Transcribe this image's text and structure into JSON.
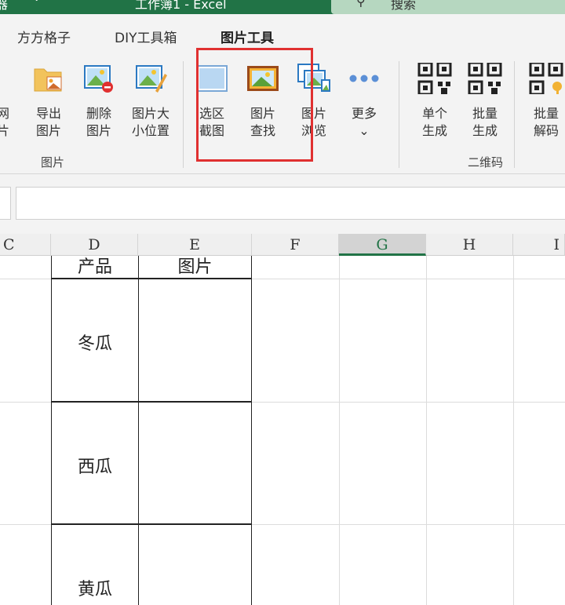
{
  "titlebar": {
    "left": "器",
    "app": "工作簿1 - Excel",
    "search": "搜索"
  },
  "tabs": [
    "方方格子",
    "DIY工具箱",
    "图片工具"
  ],
  "ribbon": {
    "buttons": [
      {
        "id": "net",
        "label": "网\n片"
      },
      {
        "id": "export",
        "label": "导出\n图片"
      },
      {
        "id": "delete",
        "label": "删除\n图片"
      },
      {
        "id": "size",
        "label": "图片大\n小位置"
      },
      {
        "id": "crop",
        "label": "选区\n截图"
      },
      {
        "id": "find",
        "label": "图片\n查找"
      },
      {
        "id": "browse",
        "label": "图片\n浏览"
      },
      {
        "id": "more",
        "label": "更多\n⌄"
      },
      {
        "id": "qr_single",
        "label": "单个\n生成"
      },
      {
        "id": "qr_batch",
        "label": "批量\n生成"
      },
      {
        "id": "qr_decode",
        "label": "批量\n解码"
      }
    ],
    "groups": {
      "picture": "图片",
      "qrcode": "二维码"
    }
  },
  "columns": [
    "C",
    "D",
    "E",
    "F",
    "G",
    "H",
    "I"
  ],
  "table": {
    "headers": [
      "产品",
      "图片"
    ],
    "rows": [
      "冬瓜",
      "西瓜",
      "黄瓜"
    ]
  },
  "colors": {
    "excel_green": "#217346",
    "highlight_red": "#e03030"
  }
}
